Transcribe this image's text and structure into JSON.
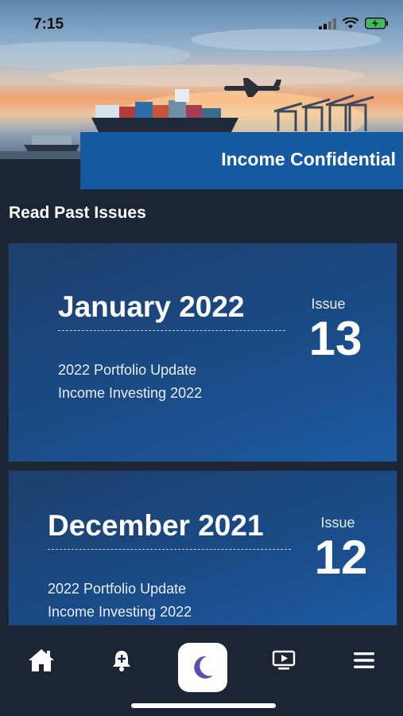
{
  "status_bar": {
    "time": "7:15"
  },
  "header": {
    "title": "Income Confidential"
  },
  "section": {
    "title": "Read Past Issues"
  },
  "issues": [
    {
      "month": "January 2022",
      "issue_label": "Issue",
      "issue_number": "13",
      "articles": [
        "2022 Portfolio Update",
        "Income Investing 2022"
      ]
    },
    {
      "month": "December 2021",
      "issue_label": "Issue",
      "issue_number": "12",
      "articles": [
        "2022 Portfolio Update",
        "Income Investing 2022"
      ]
    }
  ],
  "bottom_nav": {
    "items": [
      {
        "icon": "home-icon"
      },
      {
        "icon": "notification-bell-icon"
      },
      {
        "icon": "moon-icon"
      },
      {
        "icon": "video-play-icon"
      },
      {
        "icon": "hamburger-menu-icon"
      }
    ]
  },
  "colors": {
    "background": "#1b2533",
    "banner_blue": "#155aa0",
    "card_blue": "#1a4b86",
    "moon_purple": "#5a4fb0"
  }
}
